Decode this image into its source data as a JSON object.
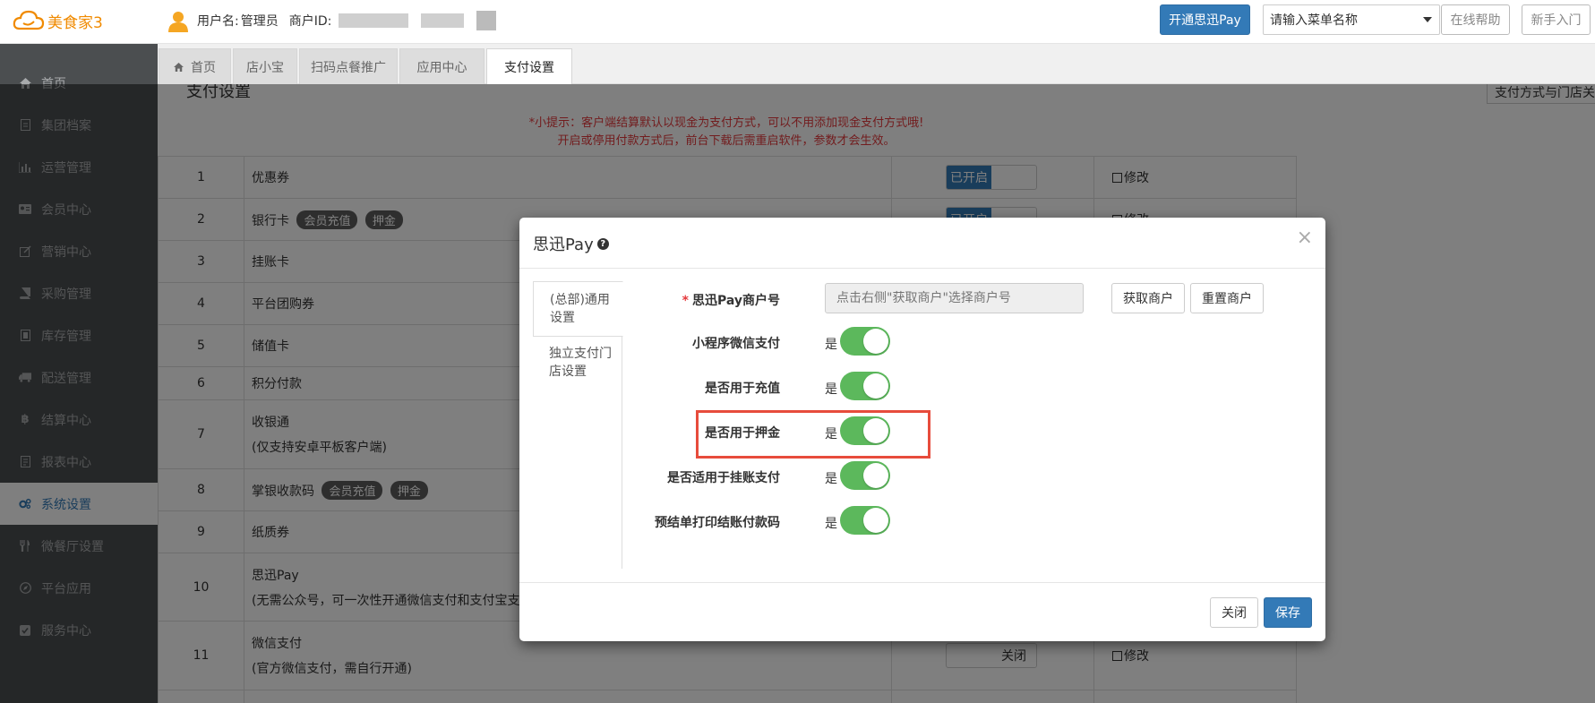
{
  "topbar": {
    "logo_text": "美食家3",
    "username_label": "用户名:",
    "username": "管理员",
    "merchant_id_label": "商户ID:",
    "open_pay_button": "开通思迅Pay",
    "menu_search_placeholder": "请输入菜单名称",
    "online_help": "在线帮助",
    "beginner_guide": "新手入门"
  },
  "sidebar": {
    "items": [
      {
        "label": "首页",
        "icon": "home-icon"
      },
      {
        "label": "集团档案",
        "icon": "file-icon"
      },
      {
        "label": "运营管理",
        "icon": "bar-chart-icon"
      },
      {
        "label": "会员中心",
        "icon": "id-card-icon"
      },
      {
        "label": "营销中心",
        "icon": "edit-icon"
      },
      {
        "label": "采购管理",
        "icon": "book-icon"
      },
      {
        "label": "库存管理",
        "icon": "doc-icon"
      },
      {
        "label": "配送管理",
        "icon": "truck-icon"
      },
      {
        "label": "结算中心",
        "icon": "bitcoin-icon"
      },
      {
        "label": "报表中心",
        "icon": "report-icon"
      },
      {
        "label": "系统设置",
        "icon": "gears-icon",
        "active": true
      },
      {
        "label": "微餐厅设置",
        "icon": "cutlery-icon"
      },
      {
        "label": "平台应用",
        "icon": "compass-icon"
      },
      {
        "label": "服务中心",
        "icon": "check-square-icon"
      }
    ]
  },
  "tabs": [
    {
      "label": "首页",
      "icon": "home-icon"
    },
    {
      "label": "店小宝"
    },
    {
      "label": "扫码点餐推广"
    },
    {
      "label": "应用中心"
    },
    {
      "label": "支付设置",
      "active": true
    }
  ],
  "main": {
    "section_title": "支付设置",
    "right_button": "支付方式与门店关",
    "hint_line1": "*小提示：客户端结算默认以现金为支付方式，可以不用添加现金支付方式哦!",
    "hint_line2": "开启或停用付款方式后，前台下载后需重启软件，参数才会生效。",
    "rows": [
      {
        "num": "1",
        "name": "优惠券",
        "toggle": "已开启",
        "edit": "修改"
      },
      {
        "num": "2",
        "name": "银行卡",
        "tags": [
          "会员充值",
          "押金"
        ],
        "toggle": "已开启",
        "edit": "修改"
      },
      {
        "num": "3",
        "name": "挂账卡"
      },
      {
        "num": "4",
        "name": "平台团购券"
      },
      {
        "num": "5",
        "name": "储值卡"
      },
      {
        "num": "6",
        "name": "积分付款"
      },
      {
        "num": "7",
        "name": "收银通",
        "sub": "(仅支持安卓平板客户端)"
      },
      {
        "num": "8",
        "name": "掌银收款码",
        "tags": [
          "会员充值",
          "押金"
        ]
      },
      {
        "num": "9",
        "name": "纸质券"
      },
      {
        "num": "10",
        "name": "思迅Pay",
        "sub": "(无需公众号，可一次性开通微信支付和支付宝支"
      },
      {
        "num": "11",
        "name": "微信支付",
        "sub": "(官方微信支付，需自行开通)",
        "toggle_off": "关闭",
        "edit": "修改"
      }
    ]
  },
  "modal": {
    "title": "思迅Pay",
    "close": "×",
    "nav": [
      {
        "label": "(总部)通用设置",
        "active": true
      },
      {
        "label": "独立支付门店设置"
      }
    ],
    "merchant_label": "思迅Pay商户号",
    "merchant_placeholder": "点击右侧\"获取商户\"选择商户号",
    "get_merchant": "获取商户",
    "reset_merchant": "重置商户",
    "switches": [
      {
        "label": "小程序微信支付",
        "state": "是",
        "on": true
      },
      {
        "label": "是否用于充值",
        "state": "是",
        "on": true
      },
      {
        "label": "是否用于押金",
        "state": "是",
        "on": true,
        "highlighted": true
      },
      {
        "label": "是否适用于挂账支付",
        "state": "是",
        "on": true
      },
      {
        "label": "预结单打印结账付款码",
        "state": "是",
        "on": true
      }
    ],
    "close_button": "关闭",
    "save_button": "保存"
  },
  "colors": {
    "primary": "#337ab7",
    "switch_on": "#5cb85c",
    "highlight": "#e74c3c",
    "sidebar_bg": "#4b4e50",
    "logo": "#f08a00"
  }
}
